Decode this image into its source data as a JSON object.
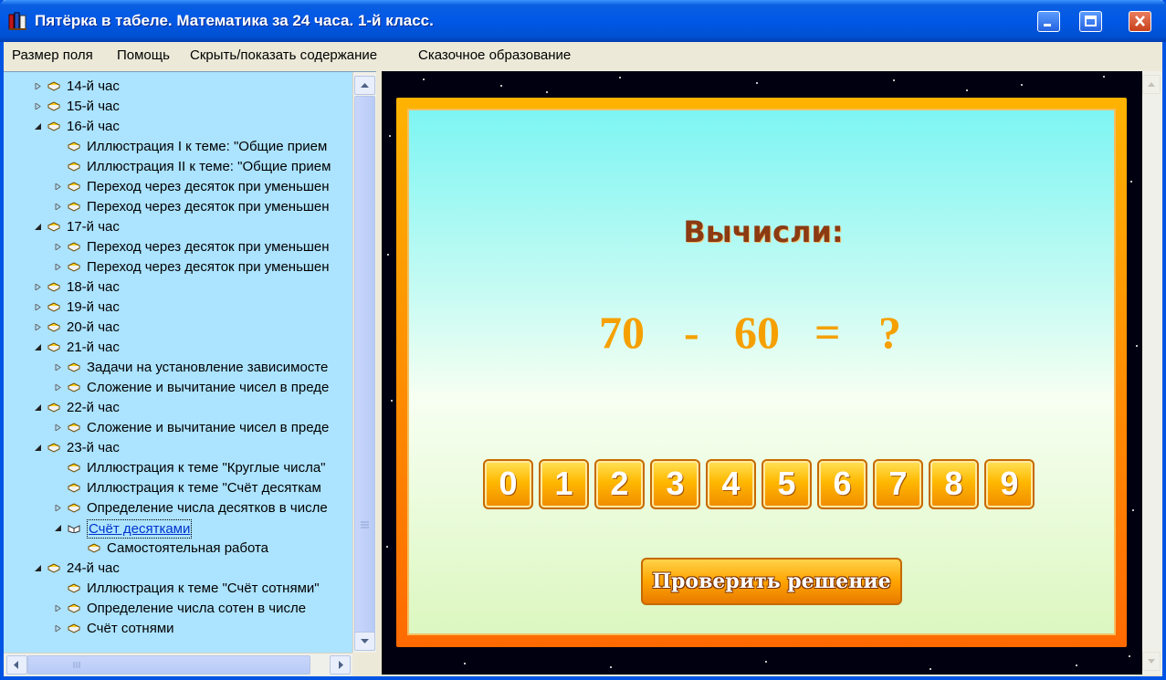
{
  "window": {
    "title": "Пятёрка в табеле. Математика за 24 часа. 1-й класс."
  },
  "menu": {
    "items": [
      {
        "label": "Размер поля",
        "underline": "Р"
      },
      {
        "label": "Помощь"
      },
      {
        "label": "Скрыть/показать содержание"
      },
      {
        "label": "Сказочное образование"
      }
    ]
  },
  "tree": {
    "rows": [
      {
        "label": "14-й час",
        "level": 0,
        "expander": "collapsed",
        "icon": "book-closed"
      },
      {
        "label": "15-й час",
        "level": 0,
        "expander": "collapsed",
        "icon": "book-closed"
      },
      {
        "label": "16-й час",
        "level": 0,
        "expander": "expanded",
        "icon": "book-closed"
      },
      {
        "label": "Иллюстрация I к теме: \"Общие прием",
        "level": 1,
        "expander": "none",
        "icon": "book-closed"
      },
      {
        "label": "Иллюстрация II к теме: \"Общие прием",
        "level": 1,
        "expander": "none",
        "icon": "book-closed"
      },
      {
        "label": "Переход через десяток при уменьшен",
        "level": 1,
        "expander": "collapsed",
        "icon": "book-closed"
      },
      {
        "label": "Переход через десяток при уменьшен",
        "level": 1,
        "expander": "collapsed",
        "icon": "book-closed"
      },
      {
        "label": "17-й час",
        "level": 0,
        "expander": "expanded",
        "icon": "book-closed"
      },
      {
        "label": "Переход через десяток при уменьшен",
        "level": 1,
        "expander": "collapsed",
        "icon": "book-closed"
      },
      {
        "label": "Переход через десяток при уменьшен",
        "level": 1,
        "expander": "collapsed",
        "icon": "book-closed"
      },
      {
        "label": "18-й час",
        "level": 0,
        "expander": "collapsed",
        "icon": "book-closed"
      },
      {
        "label": "19-й час",
        "level": 0,
        "expander": "collapsed",
        "icon": "book-closed"
      },
      {
        "label": "20-й час",
        "level": 0,
        "expander": "collapsed",
        "icon": "book-closed"
      },
      {
        "label": "21-й час",
        "level": 0,
        "expander": "expanded",
        "icon": "book-closed"
      },
      {
        "label": "Задачи на установление зависимосте",
        "level": 1,
        "expander": "collapsed",
        "icon": "book-closed"
      },
      {
        "label": "Сложение и вычитание чисел в преде",
        "level": 1,
        "expander": "collapsed",
        "icon": "book-closed"
      },
      {
        "label": "22-й час",
        "level": 0,
        "expander": "expanded",
        "icon": "book-closed"
      },
      {
        "label": "Сложение и вычитание чисел в преде",
        "level": 1,
        "expander": "collapsed",
        "icon": "book-closed"
      },
      {
        "label": "23-й час",
        "level": 0,
        "expander": "expanded",
        "icon": "book-closed"
      },
      {
        "label": "Иллюстрация к теме \"Круглые числа\"",
        "level": 1,
        "expander": "none",
        "icon": "book-closed"
      },
      {
        "label": "Иллюстрация к теме \"Счёт десяткам",
        "level": 1,
        "expander": "none",
        "icon": "book-closed"
      },
      {
        "label": "Определение числа десятков в числе",
        "level": 1,
        "expander": "collapsed",
        "icon": "book-closed"
      },
      {
        "label": "Счёт десятками",
        "level": 1,
        "expander": "expanded",
        "icon": "book-open",
        "selected": true
      },
      {
        "label": "Самостоятельная работа",
        "level": 2,
        "expander": "none",
        "icon": "book-closed"
      },
      {
        "label": "24-й час",
        "level": 0,
        "expander": "expanded",
        "icon": "book-closed"
      },
      {
        "label": "Иллюстрация к теме \"Счёт сотнями\"",
        "level": 1,
        "expander": "none",
        "icon": "book-closed"
      },
      {
        "label": "Определение числа сотен в числе",
        "level": 1,
        "expander": "collapsed",
        "icon": "book-closed"
      },
      {
        "label": "Счёт сотнями",
        "level": 1,
        "expander": "collapsed",
        "icon": "book-closed"
      }
    ]
  },
  "game": {
    "heading": "Вычисли:",
    "expression": {
      "a": "70",
      "op": "-",
      "b": "60",
      "eq": "=",
      "result": "?"
    },
    "digits": [
      "0",
      "1",
      "2",
      "3",
      "4",
      "5",
      "6",
      "7",
      "8",
      "9"
    ],
    "check_label": "Проверить решение"
  },
  "colors": {
    "accent": "#0054e3",
    "tree_bg": "#ace3ff",
    "orange": "#f5a000",
    "heading": "#8b3a12"
  }
}
